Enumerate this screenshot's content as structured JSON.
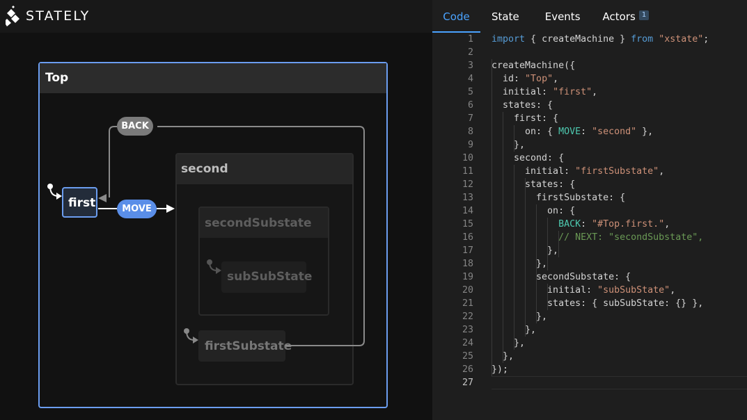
{
  "app": {
    "name": "STATELY"
  },
  "tabs": [
    {
      "label": "Code",
      "active": true
    },
    {
      "label": "State",
      "active": false
    },
    {
      "label": "Events",
      "active": false
    },
    {
      "label": "Actors",
      "active": false,
      "badge": "1"
    }
  ],
  "diagram": {
    "states": {
      "top": "Top",
      "first": "first",
      "second": "second",
      "secondSubstate": "secondSubstate",
      "subSubState": "subSubState",
      "firstSubstate": "firstSubstate"
    },
    "transitions": {
      "back": "BACK",
      "move": "MOVE"
    }
  },
  "code": {
    "current_line": 27,
    "lines": [
      [
        [
          "import",
          "kw"
        ],
        [
          " { createMachine } ",
          "p"
        ],
        [
          "from",
          "kw"
        ],
        [
          " ",
          "p"
        ],
        [
          "\"xstate\"",
          "s"
        ],
        [
          ";",
          "p"
        ]
      ],
      [],
      [
        [
          "createMachine({",
          "p"
        ]
      ],
      [
        [
          "  id: ",
          "p"
        ],
        [
          "\"Top\"",
          "s"
        ],
        [
          ",",
          "p"
        ]
      ],
      [
        [
          "  initial: ",
          "p"
        ],
        [
          "\"first\"",
          "s"
        ],
        [
          ",",
          "p"
        ]
      ],
      [
        [
          "  states: {",
          "p"
        ]
      ],
      [
        [
          "    first: {",
          "p"
        ]
      ],
      [
        [
          "      on: { ",
          "p"
        ],
        [
          "MOVE",
          "k"
        ],
        [
          ": ",
          "p"
        ],
        [
          "\"second\"",
          "s"
        ],
        [
          " },",
          "p"
        ]
      ],
      [
        [
          "    },",
          "p"
        ]
      ],
      [
        [
          "    second: {",
          "p"
        ]
      ],
      [
        [
          "      initial: ",
          "p"
        ],
        [
          "\"firstSubstate\"",
          "s"
        ],
        [
          ",",
          "p"
        ]
      ],
      [
        [
          "      states: {",
          "p"
        ]
      ],
      [
        [
          "        firstSubstate: {",
          "p"
        ]
      ],
      [
        [
          "          on: {",
          "p"
        ]
      ],
      [
        [
          "            ",
          "p"
        ],
        [
          "BACK",
          "k"
        ],
        [
          ": ",
          "p"
        ],
        [
          "\"#Top.first.\"",
          "s"
        ],
        [
          ",",
          "p"
        ]
      ],
      [
        [
          "            ",
          "p"
        ],
        [
          "// NEXT: \"secondSubstate\",",
          "c"
        ]
      ],
      [
        [
          "          },",
          "p"
        ]
      ],
      [
        [
          "        },",
          "p"
        ]
      ],
      [
        [
          "        secondSubstate: {",
          "p"
        ]
      ],
      [
        [
          "          initial: ",
          "p"
        ],
        [
          "\"subSubState\"",
          "s"
        ],
        [
          ",",
          "p"
        ]
      ],
      [
        [
          "          states: { subSubState: {} },",
          "p"
        ]
      ],
      [
        [
          "        },",
          "p"
        ]
      ],
      [
        [
          "      },",
          "p"
        ]
      ],
      [
        [
          "    },",
          "p"
        ]
      ],
      [
        [
          "  },",
          "p"
        ]
      ],
      [
        [
          "});",
          "p"
        ]
      ],
      []
    ]
  },
  "colors": {
    "keyword": "#569cd6",
    "string": "#ce9178",
    "key": "#4ec9b0",
    "comment": "#6a9955",
    "plain": "#d4d4d4",
    "accent": "#4aa3ff"
  }
}
